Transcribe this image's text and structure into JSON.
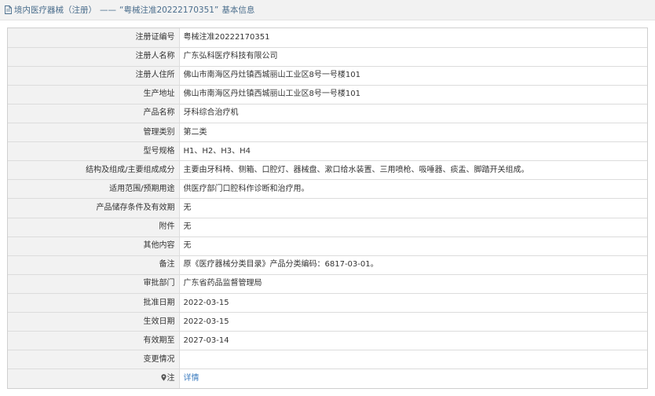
{
  "header": {
    "section": "境内医疗器械（注册）",
    "dash": "——",
    "record_title": "“粤械注准20222170351”",
    "suffix": "基本信息"
  },
  "rows": [
    {
      "label": "注册证编号",
      "value": "粤械注准20222170351"
    },
    {
      "label": "注册人名称",
      "value": "广东弘科医疗科技有限公司"
    },
    {
      "label": "注册人住所",
      "value": "佛山市南海区丹灶镇西城丽山工业区8号一号楼101"
    },
    {
      "label": "生产地址",
      "value": "佛山市南海区丹灶镇西城丽山工业区8号一号楼101"
    },
    {
      "label": "产品名称",
      "value": "牙科综合治疗机"
    },
    {
      "label": "管理类别",
      "value": "第二类"
    },
    {
      "label": "型号规格",
      "value": "H1、H2、H3、H4"
    },
    {
      "label": "结构及组成/主要组成成分",
      "value": "主要由牙科椅、侧箱、口腔灯、器械盘、漱口给水装置、三用喷枪、吸唾器、痰盂、脚踏开关组成。"
    },
    {
      "label": "适用范围/预期用途",
      "value": "供医疗部门口腔科作诊断和治疗用。"
    },
    {
      "label": "产品储存条件及有效期",
      "value": "无"
    },
    {
      "label": "附件",
      "value": "无"
    },
    {
      "label": "其他内容",
      "value": "无"
    },
    {
      "label": "备注",
      "value": "原《医疗器械分类目录》产品分类编码：6817-03-01。"
    },
    {
      "label": "审批部门",
      "value": "广东省药品监督管理局"
    },
    {
      "label": "批准日期",
      "value": "2022-03-15"
    },
    {
      "label": "生效日期",
      "value": "2022-03-15"
    },
    {
      "label": "有效期至",
      "value": "2027-03-14"
    },
    {
      "label": "变更情况",
      "value": ""
    }
  ],
  "note_row": {
    "label": "注",
    "link": "详情",
    "icon": "location-pin-icon"
  },
  "colors": {
    "title": "#4a6d8c",
    "link": "#3b7bbf",
    "label_bg": "#f2f2f2",
    "border": "#dcdcdc"
  }
}
